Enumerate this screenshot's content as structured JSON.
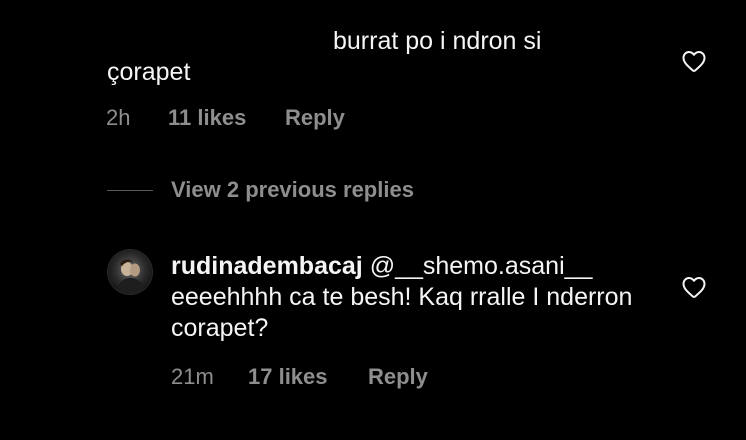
{
  "comment": {
    "text_line1": "burrat po i ndron si",
    "text_line2": "çorapet",
    "time": "2h",
    "likes": "11 likes",
    "reply_label": "Reply"
  },
  "view_replies": {
    "label": "View 2 previous replies"
  },
  "reply": {
    "username": "rudinadembacaj",
    "mention": "@__shemo.asani__",
    "text": "eeeehhhh ca te besh! Kaq rralle I nderron corapet?",
    "time": "21m",
    "likes": "17 likes",
    "reply_label": "Reply"
  },
  "icons": {
    "like": "heart-outline-icon",
    "avatar": "user-avatar-photo"
  },
  "colors": {
    "background": "#000000",
    "text": "#f5f5f5",
    "secondary": "#8e8e8e"
  }
}
